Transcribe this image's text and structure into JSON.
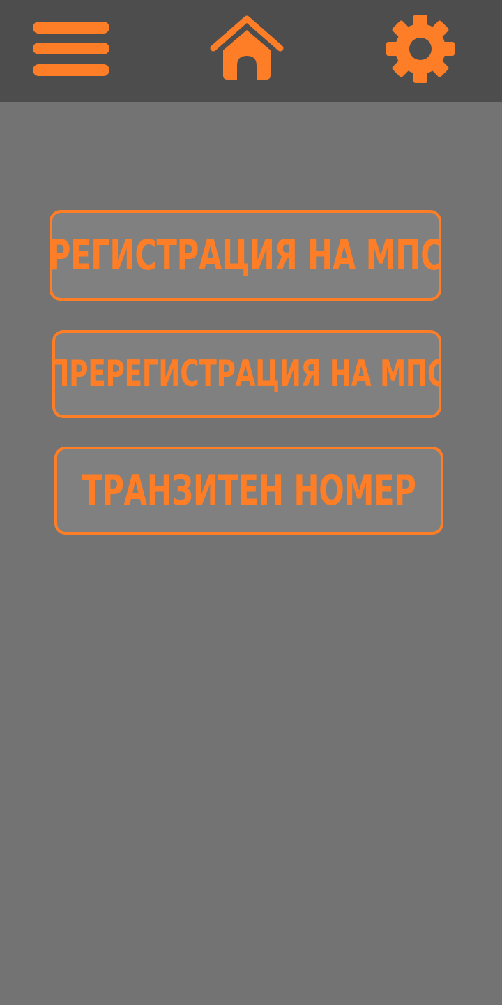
{
  "colors": {
    "accent": "#fd7e26",
    "topbar": "#4d4d4d",
    "background": "#737373",
    "button_fill": "#808080"
  },
  "topbar": {
    "menu_icon": "hamburger-menu-icon",
    "home_icon": "home-icon",
    "settings_icon": "gear-icon"
  },
  "main": {
    "buttons": [
      {
        "label": "РЕГИСТРАЦИЯ НА МПС"
      },
      {
        "label": "ПРЕРЕГИСТРАЦИЯ НА МПС"
      },
      {
        "label": "ТРАНЗИТЕН НОМЕР"
      }
    ]
  }
}
